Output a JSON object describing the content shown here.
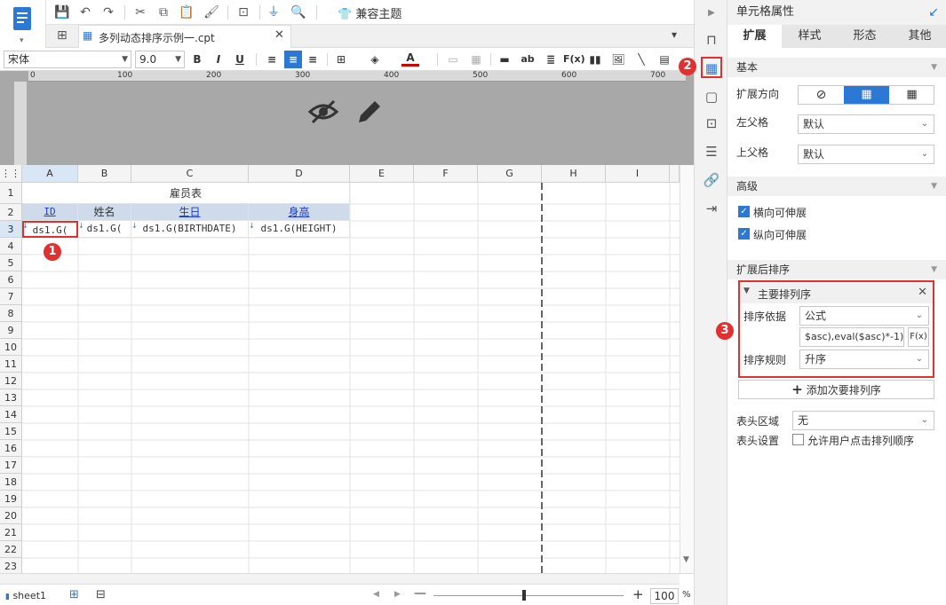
{
  "toolbar": {
    "theme_label": "兼容主题"
  },
  "tab": {
    "doc_name": "多列动态排序示例一.cpt"
  },
  "format": {
    "font_name": "宋体",
    "font_size": "9.0"
  },
  "ruler": {
    "ticks": [
      "0",
      "100",
      "200",
      "300",
      "400",
      "500",
      "600",
      "700"
    ]
  },
  "grid": {
    "columns": [
      "A",
      "B",
      "C",
      "D",
      "E",
      "F",
      "G",
      "H",
      "I"
    ],
    "rows": [
      "1",
      "2",
      "3",
      "4",
      "5",
      "6",
      "7",
      "8",
      "9",
      "10",
      "11",
      "12",
      "13",
      "14",
      "15",
      "16",
      "17",
      "18",
      "19",
      "20",
      "21",
      "22",
      "23"
    ],
    "title_cell": "雇员表",
    "header_id": "ID",
    "header_name": "姓名",
    "header_birth": "生日",
    "header_height": "身高",
    "data_id": "ds1.G(",
    "data_name": "ds1.G(",
    "data_birth": "ds1.G(BIRTHDATE)",
    "data_height": "ds1.G(HEIGHT)"
  },
  "bottom": {
    "sheet": "sheet1",
    "zoom": "100",
    "pct": "%"
  },
  "panel": {
    "title": "单元格属性",
    "tabs": [
      "扩展",
      "样式",
      "形态",
      "其他"
    ],
    "basic": "基本",
    "expand_dir": "扩展方向",
    "left_parent": "左父格",
    "left_parent_val": "默认",
    "up_parent": "上父格",
    "up_parent_val": "默认",
    "advanced": "高级",
    "h_expand": "横向可伸展",
    "v_expand": "纵向可伸展",
    "sort_section": "扩展后排序",
    "main_sort": "主要排列序",
    "sort_basis": "排序依据",
    "sort_basis_val": "公式",
    "formula": "$asc),eval($asc)*-1)",
    "sort_rule": "排序规则",
    "sort_rule_val": "升序",
    "add_sort": "添加次要排列序",
    "header_area": "表头区域",
    "header_area_val": "无",
    "header_setting": "表头设置",
    "allow_click": "允许用户点击排列顺序"
  },
  "badges": [
    "1",
    "2",
    "3"
  ],
  "colors": {
    "accent": "#2b79d4",
    "badge": "#e03030",
    "selection": "#d9e6f5"
  }
}
